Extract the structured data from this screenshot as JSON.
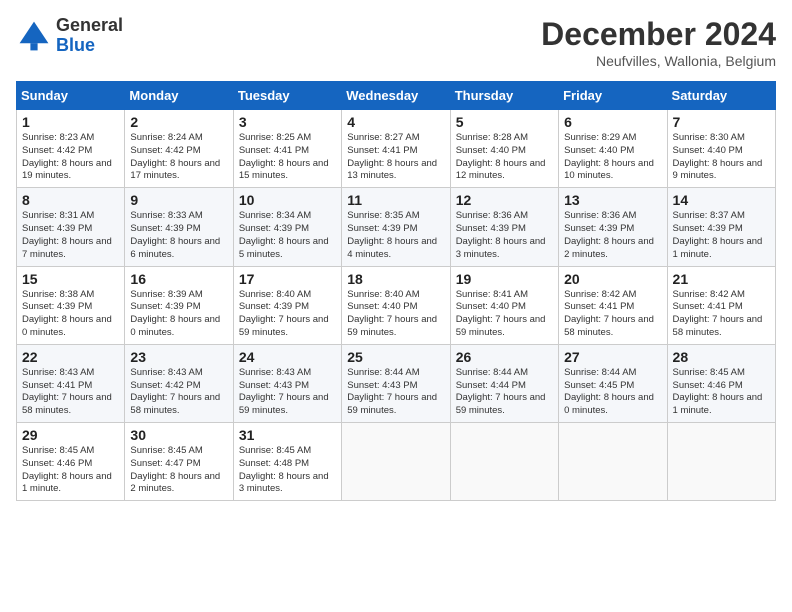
{
  "header": {
    "logo_general": "General",
    "logo_blue": "Blue",
    "month_year": "December 2024",
    "location": "Neufvilles, Wallonia, Belgium"
  },
  "weekdays": [
    "Sunday",
    "Monday",
    "Tuesday",
    "Wednesday",
    "Thursday",
    "Friday",
    "Saturday"
  ],
  "weeks": [
    [
      {
        "day": "1",
        "info": "Sunrise: 8:23 AM\nSunset: 4:42 PM\nDaylight: 8 hours and 19 minutes."
      },
      {
        "day": "2",
        "info": "Sunrise: 8:24 AM\nSunset: 4:42 PM\nDaylight: 8 hours and 17 minutes."
      },
      {
        "day": "3",
        "info": "Sunrise: 8:25 AM\nSunset: 4:41 PM\nDaylight: 8 hours and 15 minutes."
      },
      {
        "day": "4",
        "info": "Sunrise: 8:27 AM\nSunset: 4:41 PM\nDaylight: 8 hours and 13 minutes."
      },
      {
        "day": "5",
        "info": "Sunrise: 8:28 AM\nSunset: 4:40 PM\nDaylight: 8 hours and 12 minutes."
      },
      {
        "day": "6",
        "info": "Sunrise: 8:29 AM\nSunset: 4:40 PM\nDaylight: 8 hours and 10 minutes."
      },
      {
        "day": "7",
        "info": "Sunrise: 8:30 AM\nSunset: 4:40 PM\nDaylight: 8 hours and 9 minutes."
      }
    ],
    [
      {
        "day": "8",
        "info": "Sunrise: 8:31 AM\nSunset: 4:39 PM\nDaylight: 8 hours and 7 minutes."
      },
      {
        "day": "9",
        "info": "Sunrise: 8:33 AM\nSunset: 4:39 PM\nDaylight: 8 hours and 6 minutes."
      },
      {
        "day": "10",
        "info": "Sunrise: 8:34 AM\nSunset: 4:39 PM\nDaylight: 8 hours and 5 minutes."
      },
      {
        "day": "11",
        "info": "Sunrise: 8:35 AM\nSunset: 4:39 PM\nDaylight: 8 hours and 4 minutes."
      },
      {
        "day": "12",
        "info": "Sunrise: 8:36 AM\nSunset: 4:39 PM\nDaylight: 8 hours and 3 minutes."
      },
      {
        "day": "13",
        "info": "Sunrise: 8:36 AM\nSunset: 4:39 PM\nDaylight: 8 hours and 2 minutes."
      },
      {
        "day": "14",
        "info": "Sunrise: 8:37 AM\nSunset: 4:39 PM\nDaylight: 8 hours and 1 minute."
      }
    ],
    [
      {
        "day": "15",
        "info": "Sunrise: 8:38 AM\nSunset: 4:39 PM\nDaylight: 8 hours and 0 minutes."
      },
      {
        "day": "16",
        "info": "Sunrise: 8:39 AM\nSunset: 4:39 PM\nDaylight: 8 hours and 0 minutes."
      },
      {
        "day": "17",
        "info": "Sunrise: 8:40 AM\nSunset: 4:39 PM\nDaylight: 7 hours and 59 minutes."
      },
      {
        "day": "18",
        "info": "Sunrise: 8:40 AM\nSunset: 4:40 PM\nDaylight: 7 hours and 59 minutes."
      },
      {
        "day": "19",
        "info": "Sunrise: 8:41 AM\nSunset: 4:40 PM\nDaylight: 7 hours and 59 minutes."
      },
      {
        "day": "20",
        "info": "Sunrise: 8:42 AM\nSunset: 4:41 PM\nDaylight: 7 hours and 58 minutes."
      },
      {
        "day": "21",
        "info": "Sunrise: 8:42 AM\nSunset: 4:41 PM\nDaylight: 7 hours and 58 minutes."
      }
    ],
    [
      {
        "day": "22",
        "info": "Sunrise: 8:43 AM\nSunset: 4:41 PM\nDaylight: 7 hours and 58 minutes."
      },
      {
        "day": "23",
        "info": "Sunrise: 8:43 AM\nSunset: 4:42 PM\nDaylight: 7 hours and 58 minutes."
      },
      {
        "day": "24",
        "info": "Sunrise: 8:43 AM\nSunset: 4:43 PM\nDaylight: 7 hours and 59 minutes."
      },
      {
        "day": "25",
        "info": "Sunrise: 8:44 AM\nSunset: 4:43 PM\nDaylight: 7 hours and 59 minutes."
      },
      {
        "day": "26",
        "info": "Sunrise: 8:44 AM\nSunset: 4:44 PM\nDaylight: 7 hours and 59 minutes."
      },
      {
        "day": "27",
        "info": "Sunrise: 8:44 AM\nSunset: 4:45 PM\nDaylight: 8 hours and 0 minutes."
      },
      {
        "day": "28",
        "info": "Sunrise: 8:45 AM\nSunset: 4:46 PM\nDaylight: 8 hours and 1 minute."
      }
    ],
    [
      {
        "day": "29",
        "info": "Sunrise: 8:45 AM\nSunset: 4:46 PM\nDaylight: 8 hours and 1 minute."
      },
      {
        "day": "30",
        "info": "Sunrise: 8:45 AM\nSunset: 4:47 PM\nDaylight: 8 hours and 2 minutes."
      },
      {
        "day": "31",
        "info": "Sunrise: 8:45 AM\nSunset: 4:48 PM\nDaylight: 8 hours and 3 minutes."
      },
      null,
      null,
      null,
      null
    ]
  ]
}
